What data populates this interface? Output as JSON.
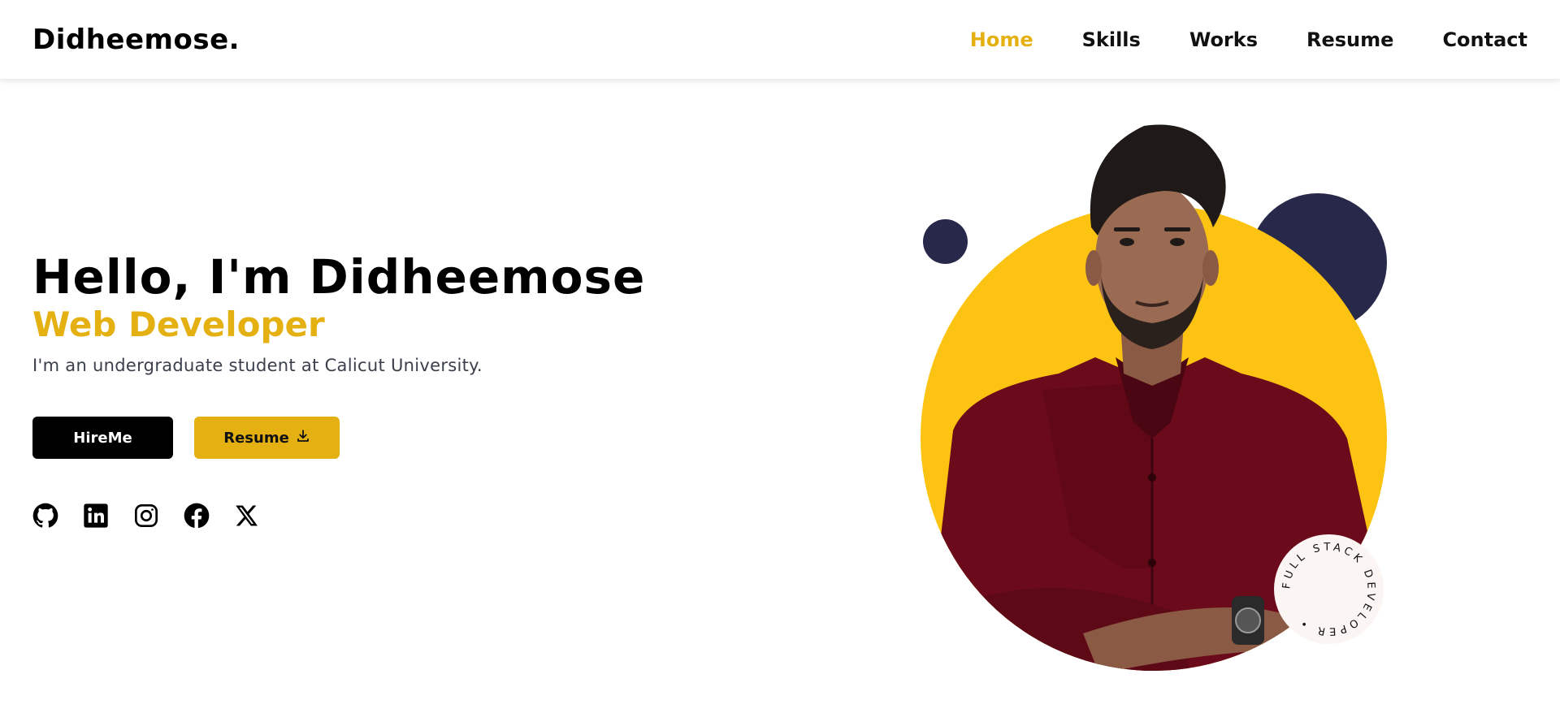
{
  "header": {
    "logo": "Didheemose.",
    "nav": [
      {
        "label": "Home",
        "active": true
      },
      {
        "label": "Skills",
        "active": false
      },
      {
        "label": "Works",
        "active": false
      },
      {
        "label": "Resume",
        "active": false
      },
      {
        "label": "Contact",
        "active": false
      }
    ]
  },
  "hero": {
    "greeting": "Hello, I'm Didheemose",
    "role": "Web Developer",
    "bio": "I'm an undergraduate student at Calicut University.",
    "hire_label": "HireMe",
    "resume_label": "Resume",
    "resume_icon": "download-icon"
  },
  "socials": [
    {
      "icon": "github-icon"
    },
    {
      "icon": "linkedin-icon"
    },
    {
      "icon": "instagram-icon"
    },
    {
      "icon": "facebook-icon"
    },
    {
      "icon": "x-icon"
    }
  ],
  "portrait": {
    "badge_text": "FULL STACK DEVELOPER •"
  },
  "colors": {
    "accent": "#e4b012",
    "circle_yellow": "#fdc312",
    "navy": "#28284a",
    "shirt": "#6b0a1a"
  }
}
